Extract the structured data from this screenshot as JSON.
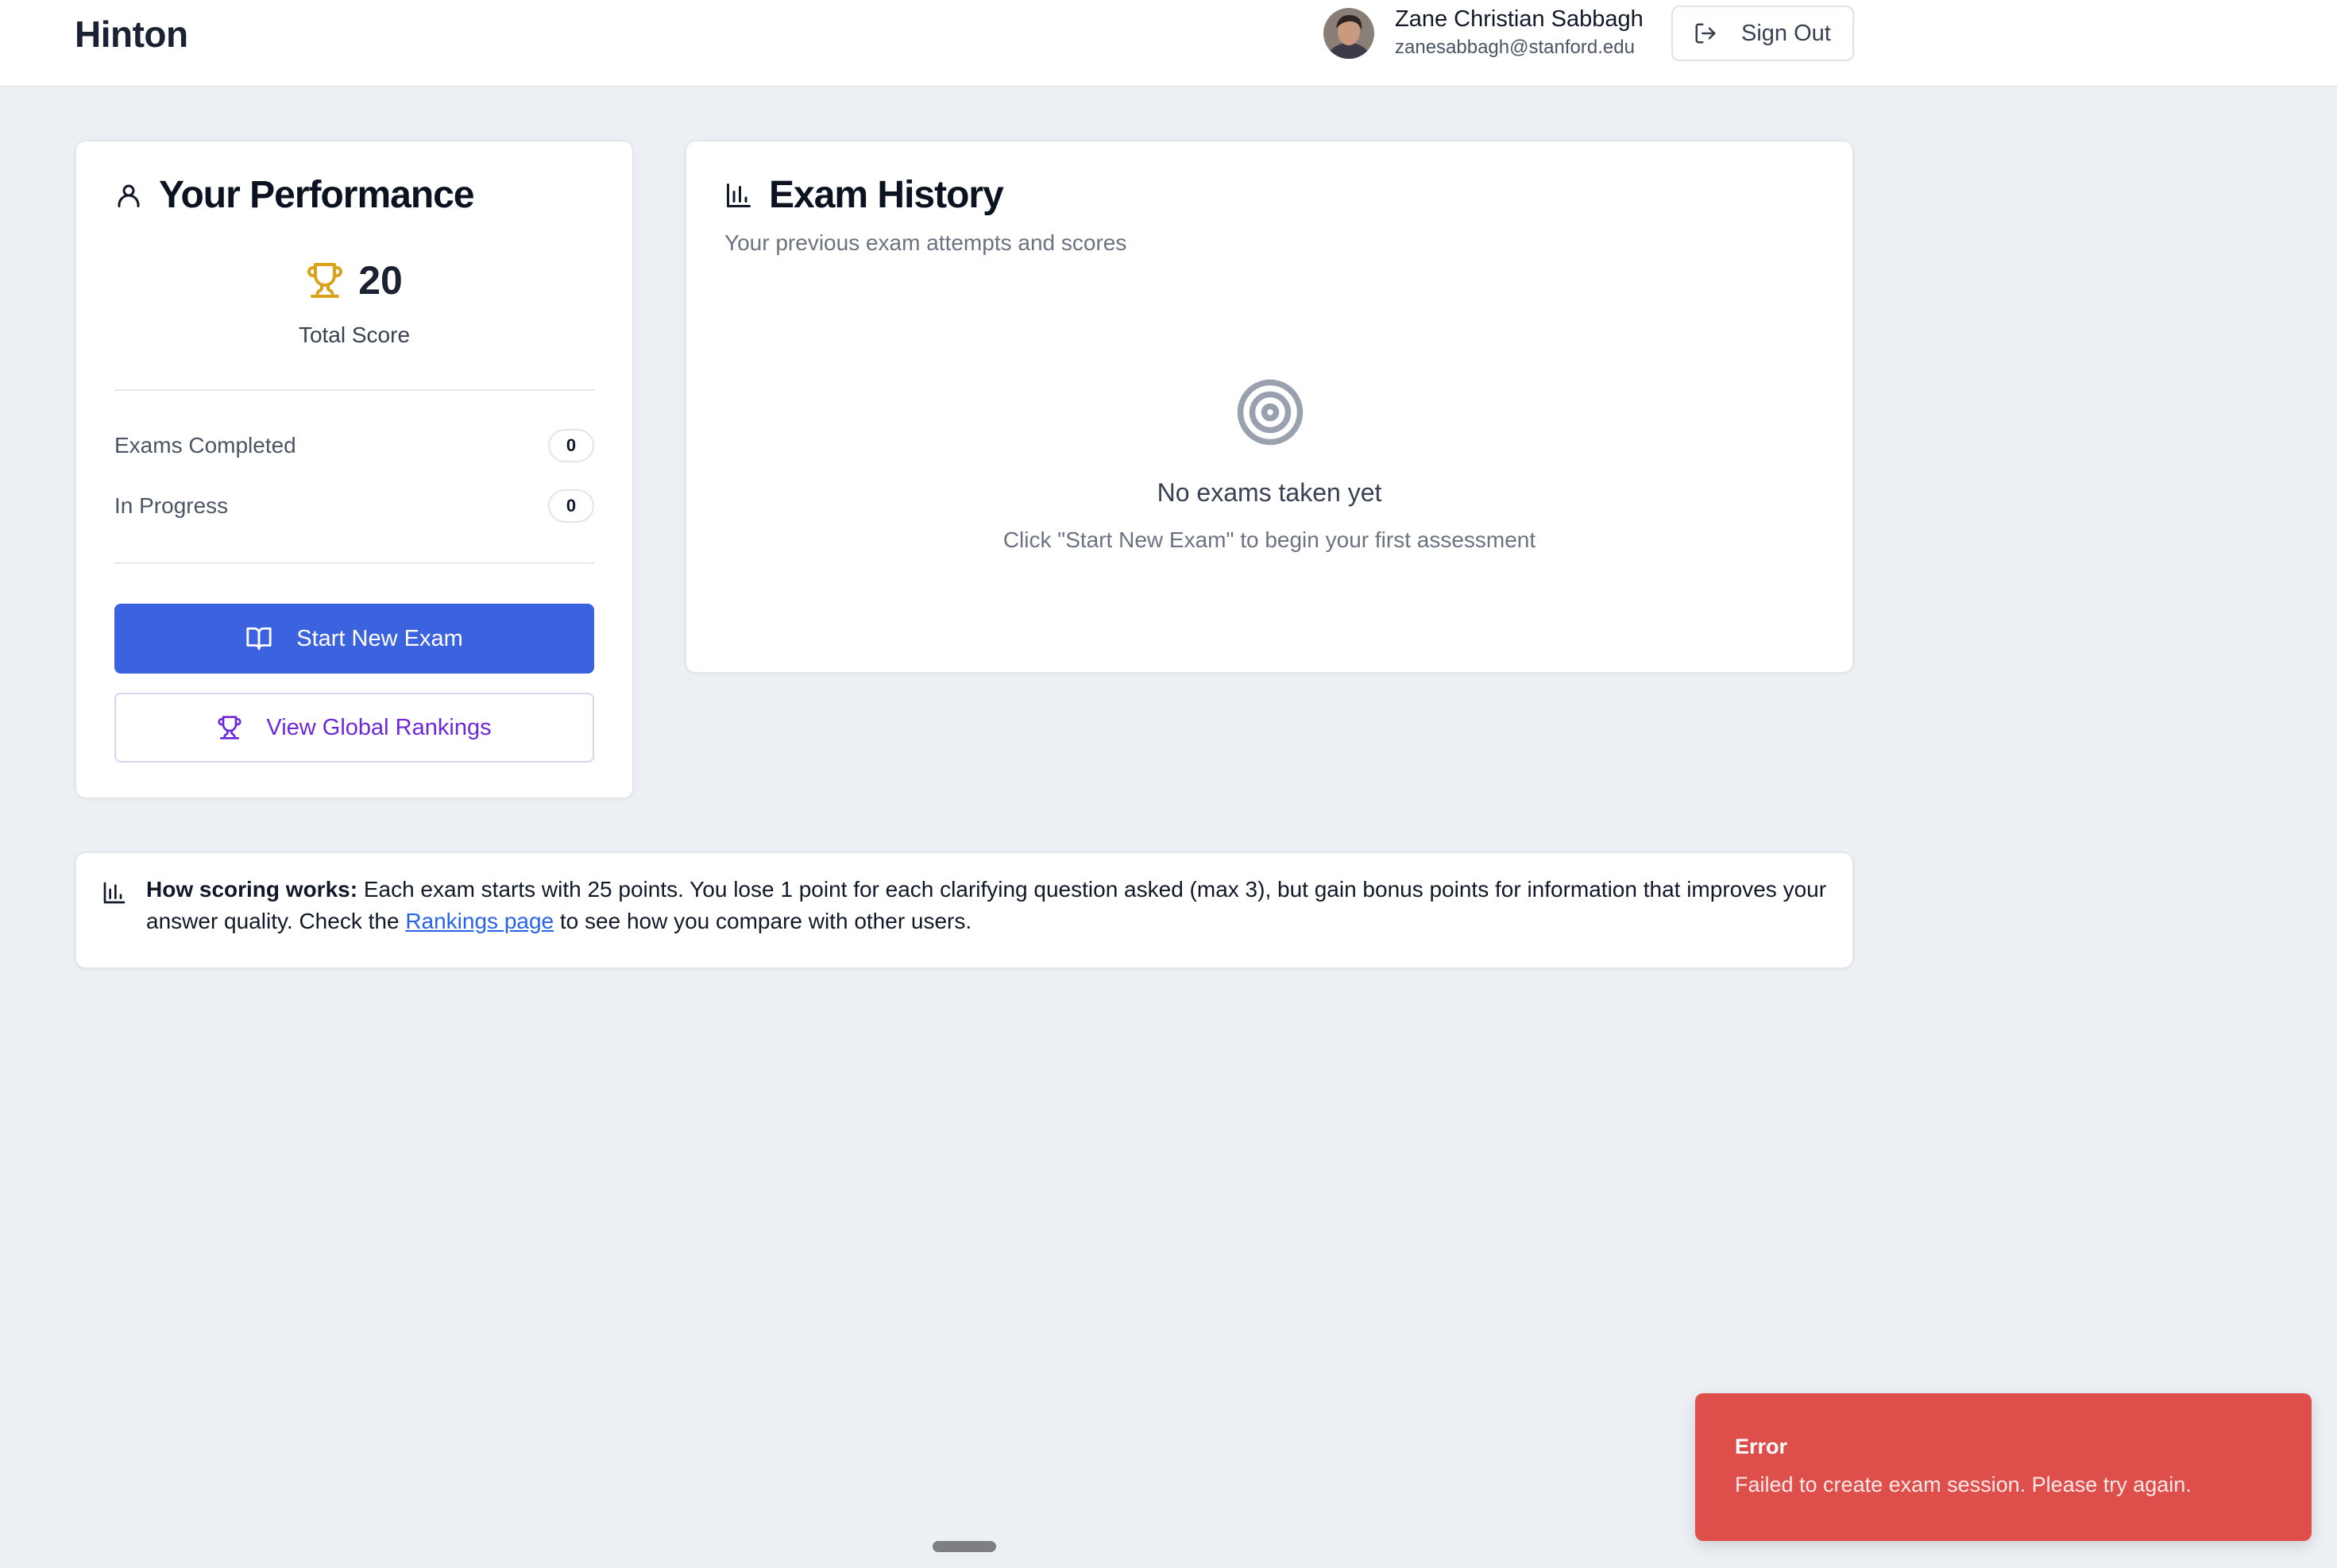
{
  "header": {
    "app_title": "Hinton",
    "user_name": "Zane Christian Sabbagh",
    "user_email": "zanesabbagh@stanford.edu",
    "sign_out_label": "Sign Out"
  },
  "performance": {
    "title": "Your Performance",
    "total_score": "20",
    "total_score_label": "Total Score",
    "stats": [
      {
        "label": "Exams Completed",
        "value": "0"
      },
      {
        "label": "In Progress",
        "value": "0"
      }
    ],
    "start_exam_label": "Start New Exam",
    "rankings_label": "View Global Rankings"
  },
  "history": {
    "title": "Exam History",
    "subtitle": "Your previous exam attempts and scores",
    "empty_title": "No exams taken yet",
    "empty_subtitle": "Click \"Start New Exam\" to begin your first assessment"
  },
  "info": {
    "bold_prefix": "How scoring works:",
    "text_before_link": " Each exam starts with 25 points. You lose 1 point for each clarifying question asked (max 3), but gain bonus points for information that improves your answer quality. Check the ",
    "link_text": "Rankings page",
    "text_after_link": " to see how you compare with other users."
  },
  "toast": {
    "title": "Error",
    "message": "Failed to create exam session. Please try again."
  },
  "colors": {
    "primary": "#3b63e0",
    "accent_purple": "#6d28d9",
    "trophy_gold": "#d9a21b",
    "error": "#de4f4c",
    "link": "#2563eb"
  },
  "icons": {
    "user": "user-icon",
    "trophy": "trophy-icon",
    "book": "book-open-icon",
    "chart": "bar-chart-icon",
    "target": "target-icon",
    "sign_out": "log-out-icon"
  }
}
